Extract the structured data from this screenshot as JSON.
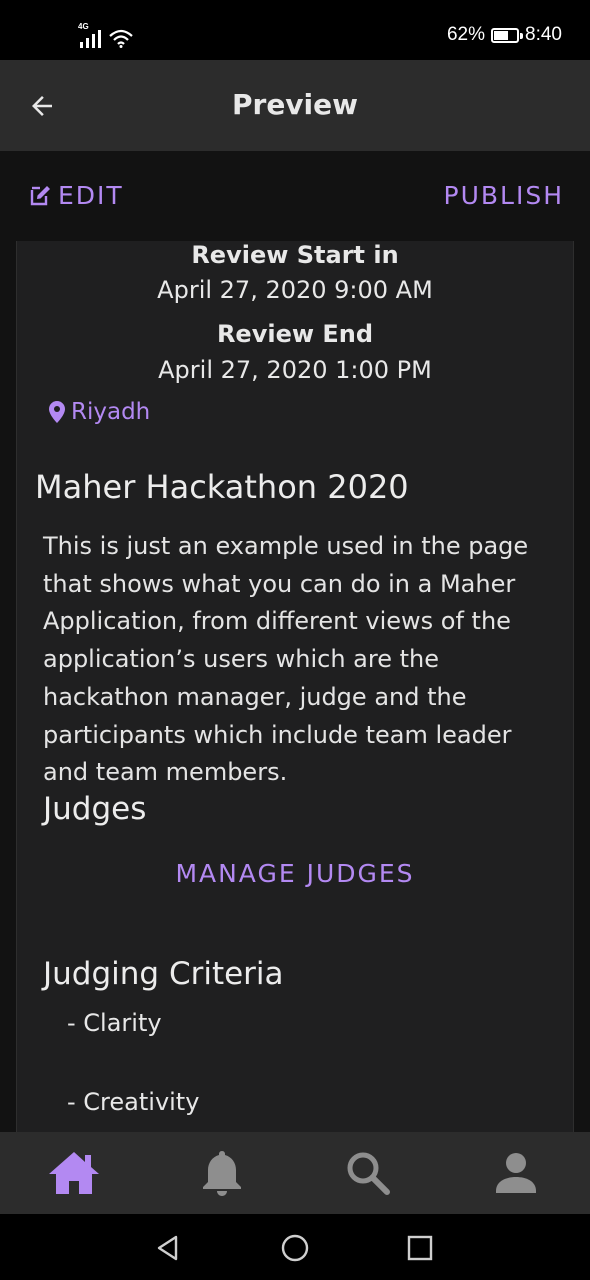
{
  "status_bar": {
    "network": "4G",
    "battery_percent": "62%",
    "battery_level": 0.62,
    "time": "8:40"
  },
  "app_bar": {
    "title": "Preview",
    "back_icon": "arrow-back-icon"
  },
  "actions": {
    "edit_label": "EDIT",
    "publish_label": "PUBLISH"
  },
  "card": {
    "review_start_label": "Review Start in",
    "review_start_date": "April 27, 2020 9:00 AM",
    "review_end_label": "Review End",
    "review_end_date": "April 27, 2020 1:00 PM",
    "location": "Riyadh",
    "hackathon_title": "Maher Hackathon 2020",
    "description": "This is just an example used in the page that shows what you can do in a Maher Application, from different views of the application’s users which are the hackathon manager, judge and the participants which include team leader and team members.",
    "judges_title": "Judges",
    "manage_judges_label": "MANAGE JUDGES",
    "criteria_title": "Judging Criteria",
    "criteria": [
      "- Clarity",
      "- Creativity"
    ]
  },
  "bottom_nav": [
    {
      "icon": "home-icon",
      "active": true
    },
    {
      "icon": "bell-icon",
      "active": false
    },
    {
      "icon": "search-icon",
      "active": false
    },
    {
      "icon": "person-icon",
      "active": false
    }
  ],
  "colors": {
    "accent": "#b389f2",
    "app_bar": "#2c2c2c",
    "card": "#1f1f20",
    "background": "#121212"
  }
}
